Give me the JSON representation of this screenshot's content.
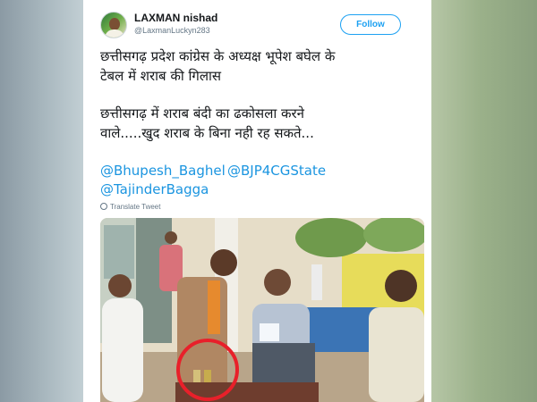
{
  "account": {
    "display_name": "LAXMAN nishad",
    "handle": "@LaxmanLuckyn283"
  },
  "follow_button": {
    "label": "Follow"
  },
  "tweet": {
    "lines": [
      "छत्तीसगढ़ प्रदेश कांग्रेस के अध्यक्ष भूपेश बघेल के",
      "टेबल में शराब की गिलास",
      "छत्तीसगढ़ में शराब बंदी का ढकोसला करने",
      "वाले.....खुद शराब के बिना नही रह सकते..."
    ],
    "mentions": [
      "@Bhupesh_Baghel",
      "@BJP4CGState",
      "@TajinderBagga"
    ],
    "translate_label": "Translate Tweet"
  },
  "colors": {
    "link": "#1b95e0",
    "follow_accent": "#1da1f2",
    "highlight_circle": "#e8202a"
  },
  "photo": {
    "description_icon": "tweet-photo",
    "annotation": "red-circle-around-glasses"
  }
}
